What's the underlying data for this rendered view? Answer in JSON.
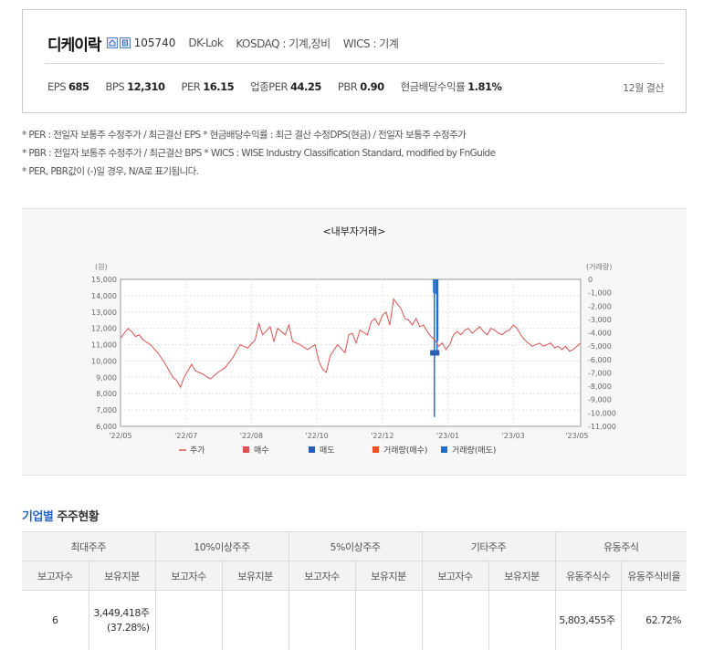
{
  "header": {
    "company_name": "디케이락",
    "code": "105740",
    "english_name": "DK-Lok",
    "market": "KOSDAQ : 기계,장비",
    "wics": "WICS : 기계",
    "settlement": "12월 결산"
  },
  "metrics": [
    {
      "label": "EPS",
      "value": "685"
    },
    {
      "label": "BPS",
      "value": "12,310"
    },
    {
      "label": "PER",
      "value": "16.15"
    },
    {
      "label": "업종PER",
      "value": "44.25"
    },
    {
      "label": "PBR",
      "value": "0.90"
    },
    {
      "label": "현금배당수익률",
      "value": "1.81%"
    }
  ],
  "notes": [
    "* PER : 전일자 보통주 수정주가 / 최근결산 EPS * 현금배당수익률 : 최근 결산 수정DPS(현금) / 전일자 보통주 수정주가",
    "* PBR : 전일자 보통주 수정주가 / 최근결산 BPS * WICS : WISE Industry Classification Standard, modified by FnGuide",
    "* PER, PBR값이 (-)일 경우, N/A로 표기됩니다."
  ],
  "chart_data": {
    "type": "line",
    "title": "<내부자거래>",
    "y_left_unit": "(원)",
    "y_right_unit": "(거래량)",
    "ylim_left": [
      6000,
      15000
    ],
    "ylim_right": [
      0,
      -11000
    ],
    "yticks_left": [
      "15,000",
      "14,000",
      "13,000",
      "12,000",
      "11,000",
      "10,000",
      "9,000",
      "8,000",
      "7,000",
      "6,000"
    ],
    "yticks_right": [
      "0",
      "-1,000",
      "-2,000",
      "-3,000",
      "-4,000",
      "-5,000",
      "-6,000",
      "-7,000",
      "-8,000",
      "-9,000",
      "-10,000",
      "-11,000"
    ],
    "x_ticks": [
      "'22/05",
      "'22/07",
      "'22/08",
      "'22/10",
      "'22/12",
      "'23/01",
      "'23/03",
      "'23/05"
    ],
    "grid": true,
    "legend_position": "bottom",
    "legend": [
      {
        "label": "주가",
        "color": "#d9534f",
        "kind": "line"
      },
      {
        "label": "매수",
        "color": "#d9534f",
        "kind": "square"
      },
      {
        "label": "매도",
        "color": "#2b5fb4",
        "kind": "square"
      },
      {
        "label": "거래량(매수)",
        "color": "#f04e23",
        "kind": "bar"
      },
      {
        "label": "거래량(매도)",
        "color": "#1f6fd0",
        "kind": "bar"
      }
    ],
    "price_series": {
      "name": "주가",
      "color": "#d9534f",
      "points": [
        [
          0,
          11400
        ],
        [
          1,
          11700
        ],
        [
          2,
          12000
        ],
        [
          3,
          11800
        ],
        [
          4,
          11500
        ],
        [
          5,
          11600
        ],
        [
          6,
          11300
        ],
        [
          8,
          11000
        ],
        [
          10,
          10500
        ],
        [
          12,
          9800
        ],
        [
          14,
          9000
        ],
        [
          15,
          8800
        ],
        [
          16,
          8400
        ],
        [
          17,
          9000
        ],
        [
          18,
          9400
        ],
        [
          19,
          9800
        ],
        [
          20,
          9400
        ],
        [
          22,
          9200
        ],
        [
          24,
          8900
        ],
        [
          26,
          9300
        ],
        [
          28,
          9600
        ],
        [
          30,
          10200
        ],
        [
          32,
          11000
        ],
        [
          34,
          10800
        ],
        [
          36,
          11300
        ],
        [
          37,
          12300
        ],
        [
          38,
          11600
        ],
        [
          40,
          12100
        ],
        [
          41,
          11200
        ],
        [
          42,
          12000
        ],
        [
          44,
          11600
        ],
        [
          45,
          12200
        ],
        [
          46,
          11200
        ],
        [
          48,
          11000
        ],
        [
          50,
          10700
        ],
        [
          52,
          11000
        ],
        [
          53,
          10000
        ],
        [
          54,
          9500
        ],
        [
          55,
          9300
        ],
        [
          56,
          10300
        ],
        [
          58,
          11000
        ],
        [
          60,
          10500
        ],
        [
          61,
          11600
        ],
        [
          62,
          11700
        ],
        [
          63,
          11100
        ],
        [
          64,
          11900
        ],
        [
          66,
          11600
        ],
        [
          67,
          12400
        ],
        [
          68,
          12600
        ],
        [
          69,
          12200
        ],
        [
          70,
          12800
        ],
        [
          71,
          13000
        ],
        [
          72,
          12200
        ],
        [
          73,
          13800
        ],
        [
          74,
          13500
        ],
        [
          75,
          13200
        ],
        [
          76,
          12600
        ],
        [
          77,
          12500
        ],
        [
          78,
          12200
        ],
        [
          79,
          12600
        ],
        [
          80,
          12100
        ],
        [
          81,
          12200
        ],
        [
          82,
          11800
        ],
        [
          83,
          11500
        ],
        [
          84,
          11300
        ],
        [
          85,
          10900
        ],
        [
          86,
          11100
        ],
        [
          87,
          10700
        ],
        [
          88,
          11000
        ],
        [
          89,
          11600
        ],
        [
          90,
          11800
        ],
        [
          91,
          11600
        ],
        [
          92,
          11900
        ],
        [
          93,
          12000
        ],
        [
          94,
          11700
        ],
        [
          95,
          11900
        ],
        [
          96,
          12100
        ],
        [
          97,
          11800
        ],
        [
          98,
          11600
        ],
        [
          99,
          12000
        ],
        [
          100,
          11900
        ],
        [
          101,
          11700
        ],
        [
          102,
          11600
        ],
        [
          103,
          11800
        ],
        [
          104,
          11900
        ],
        [
          105,
          12200
        ],
        [
          106,
          12000
        ],
        [
          107,
          11600
        ],
        [
          108,
          11300
        ],
        [
          109,
          11100
        ],
        [
          110,
          10900
        ],
        [
          111,
          11000
        ],
        [
          112,
          11100
        ],
        [
          113,
          10900
        ],
        [
          114,
          11000
        ],
        [
          115,
          11100
        ],
        [
          116,
          10800
        ],
        [
          117,
          10900
        ],
        [
          118,
          10700
        ],
        [
          119,
          10900
        ],
        [
          120,
          10600
        ],
        [
          121,
          10700
        ],
        [
          122,
          10900
        ],
        [
          123,
          11100
        ]
      ]
    },
    "sell_trades": [
      [
        83.5,
        10500
      ],
      [
        84.5,
        10500
      ]
    ],
    "sell_volumes": [
      [
        83.7,
        -1000
      ],
      [
        83.9,
        -10300
      ],
      [
        84.3,
        -1100
      ],
      [
        84.6,
        -5500
      ],
      [
        84.8,
        -4600
      ]
    ],
    "x_tick_positions": [
      0,
      14,
      28,
      42,
      56,
      70,
      84,
      98,
      113,
      123
    ]
  },
  "holders_table": {
    "group_headers": [
      "최대주주",
      "10%이상주주",
      "5%이상주주",
      "기타주주",
      "유동주식"
    ],
    "sub_headers": [
      "보고자수",
      "보유지분",
      "보고자수",
      "보유지분",
      "보고자수",
      "보유지분",
      "보고자수",
      "보유지분",
      "유동주식수",
      "유동주식비율"
    ],
    "row": [
      "6",
      "3,449,418주",
      "(37.28%)",
      "",
      "",
      "",
      "",
      "",
      "",
      "5,803,455주",
      "62.72%"
    ]
  },
  "section_title": {
    "accent": "기업별",
    "rest": " 주주현황"
  }
}
